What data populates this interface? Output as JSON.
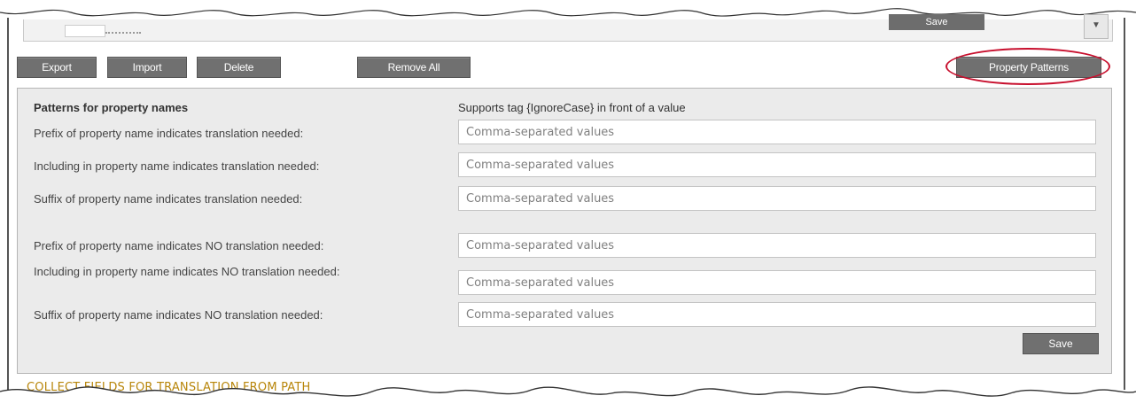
{
  "toolbar": {
    "export_label": "Export",
    "import_label": "Import",
    "delete_label": "Delete",
    "remove_all_label": "Remove All",
    "property_patterns_label": "Property Patterns"
  },
  "top_strip": {
    "button_label": "Save"
  },
  "panel": {
    "heading": "Patterns for property names",
    "hint": "Supports tag {IgnoreCase} in front of a value",
    "rows": [
      {
        "label": "Prefix of property name indicates translation needed:",
        "placeholder": "Comma-separated values"
      },
      {
        "label": "Including in property name indicates translation needed:",
        "placeholder": "Comma-separated values"
      },
      {
        "label": "Suffix of property name indicates translation needed:",
        "placeholder": "Comma-separated values"
      },
      {
        "label": "Prefix of property name indicates NO translation needed:",
        "placeholder": "Comma-separated values"
      },
      {
        "label": "Including in property name indicates NO translation needed:",
        "placeholder": "Comma-separated values"
      },
      {
        "label": "Suffix of property name indicates NO translation needed:",
        "placeholder": "Comma-separated values"
      }
    ],
    "save_label": "Save"
  },
  "bottom_section": {
    "title": "COLLECT FIELDS FOR TRANSLATION FROM PATH"
  },
  "colors": {
    "button_bg": "#707070",
    "panel_bg": "#ebebeb",
    "highlight_circle": "#c8102e",
    "section_title": "#b8860b"
  }
}
